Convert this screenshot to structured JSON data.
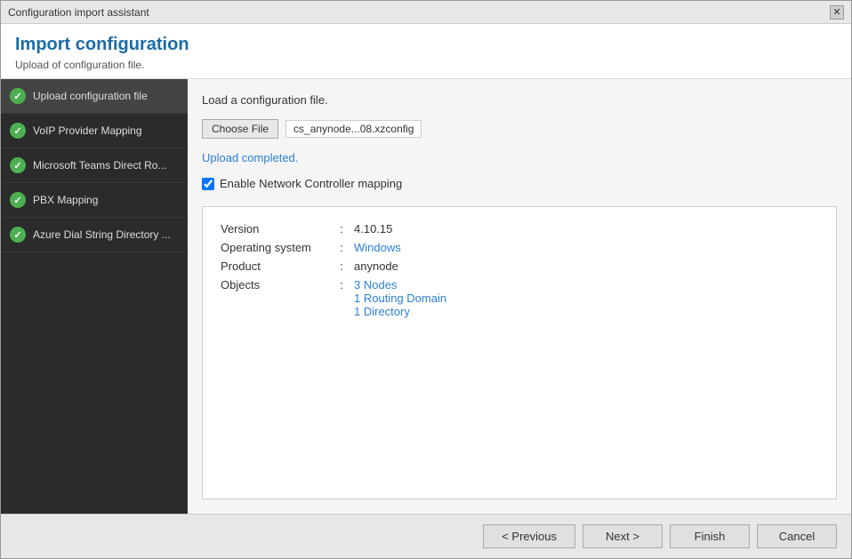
{
  "window": {
    "title": "Configuration import assistant",
    "close_label": "✕"
  },
  "header": {
    "title": "Import configuration",
    "subtitle": "Upload of configuration file."
  },
  "sidebar": {
    "items": [
      {
        "id": "upload-config",
        "label": "Upload configuration file",
        "active": true
      },
      {
        "id": "voip-provider",
        "label": "VoIP Provider Mapping",
        "active": false
      },
      {
        "id": "ms-teams",
        "label": "Microsoft Teams Direct Ro...",
        "active": false
      },
      {
        "id": "pbx-mapping",
        "label": "PBX Mapping",
        "active": false
      },
      {
        "id": "azure-dial",
        "label": "Azure Dial String Directory ...",
        "active": false
      }
    ]
  },
  "panel": {
    "instruction": "Load a configuration file.",
    "choose_file_label": "Choose File",
    "file_name": "cs_anynode...08.xzconfig",
    "upload_status": "Upload completed.",
    "enable_network_label": "Enable Network Controller mapping",
    "enable_checked": true
  },
  "info": {
    "rows": [
      {
        "label": "Version",
        "value": "4.10.15",
        "blue": false
      },
      {
        "label": "Operating system",
        "value": "Windows",
        "blue": true
      },
      {
        "label": "Product",
        "value": "anynode",
        "blue": false
      },
      {
        "label": "Objects",
        "value": "3 Nodes",
        "blue": true
      }
    ],
    "extra_objects": [
      {
        "value": "1 Routing Domain",
        "blue": true
      },
      {
        "value": "1 Directory",
        "blue": true
      }
    ]
  },
  "footer": {
    "previous_label": "< Previous",
    "next_label": "Next >",
    "finish_label": "Finish",
    "cancel_label": "Cancel"
  }
}
